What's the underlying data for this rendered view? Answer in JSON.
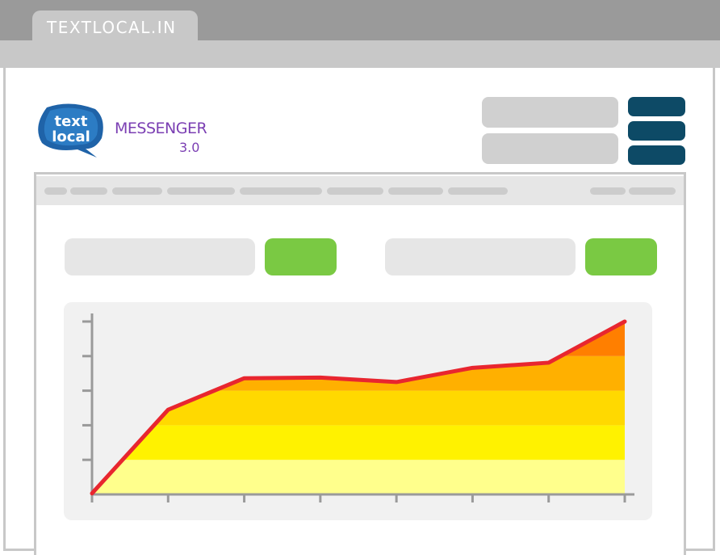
{
  "browser": {
    "tab_title": "TEXTLOCAL.IN"
  },
  "logo": {
    "line1": "text",
    "line2": "local",
    "product": "MESSENGER",
    "version": "3.0"
  },
  "colors": {
    "chrome_dark": "#9a9a9a",
    "chrome_light": "#c8c8c8",
    "logo_blue": "#1f63a8",
    "product_purple": "#7b3fb3",
    "header_button": "#0d4a66",
    "action_green": "#7ac943",
    "line_red": "#e8262f"
  },
  "chart_data": {
    "type": "area",
    "x": [
      0,
      1,
      2,
      3,
      4,
      5,
      6,
      7
    ],
    "values": [
      0.3,
      24.5,
      33.6,
      33.8,
      32.5,
      36.6,
      38.1,
      50
    ],
    "ylim": [
      0,
      50
    ],
    "y_ticks": [
      0,
      10,
      20,
      30,
      40,
      50
    ],
    "band_colors": [
      "#ffff8c",
      "#fff200",
      "#ffd900",
      "#ffb000",
      "#ff7f00"
    ],
    "line_color": "#e8262f",
    "title": "",
    "xlabel": "",
    "ylabel": "",
    "grid": false
  }
}
